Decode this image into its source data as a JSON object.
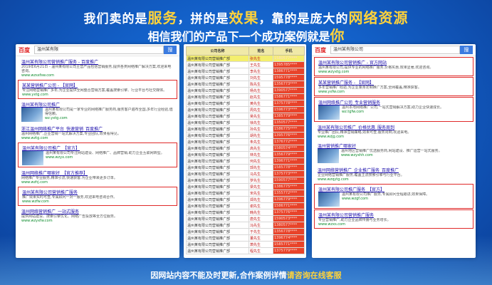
{
  "headline": {
    "line1_a": "我们卖的是",
    "line1_b": "服务",
    "line1_c": "，拼的是",
    "line1_d": "效果",
    "line1_e": "，靠的是庞大的",
    "line1_f": "网络资源",
    "line2_a": "相信我们的产品下一个成功案例就是",
    "line2_b": "你"
  },
  "left_panel": {
    "logo": "百度",
    "query": "温州某有限",
    "button": "搜",
    "results": [
      {
        "title": "温州某有限公司营销推广服务 - 百度推广",
        "snippet": "2019年6月21日 - 温州某有限公司主营产品包括营销服务,提供各类网络推广解决方案,欢迎来电咨询。",
        "url": "www.wzsxfsw.com",
        "boxed": false,
        "thumb": false
      },
      {
        "title": "某某营销推广公司 - 【官网】",
        "snippet": "专注网络营销推广多年,为企业提供全网整合营销方案,覆盖搜索引擎、行业平台与社交媒体。",
        "url": "www.yxtg.com",
        "boxed": true,
        "thumb": false
      },
      {
        "title": "温州某有限公司推广",
        "snippet": "温州某有限公司是一家专业的网络推广服务商,服务客户遍布全国,多年行业经验,值得信赖。",
        "url": "wz.yxtg.com",
        "boxed": false,
        "thumb": true
      },
      {
        "title": "浙江温州网络推广平台_快速营销_百度推广",
        "snippet": "温州网络推广,企业营销一站式解决方案,专业团队,效果看得见。",
        "url": "www.wztg.com",
        "boxed": false,
        "thumb": false
      },
      {
        "title": "温州某有限公司推广_【官方】",
        "snippet": "温州某有限公司专注网站建设、网络推广、品牌营销,助力企业互联网转型。",
        "url": "www.wzyx.com",
        "boxed": true,
        "thumb": true
      },
      {
        "title": "温州网络推广哪家好_【官方推荐】",
        "snippet": "网络推广专业服务,精准引流,快速获客,为企业带来更多订单。",
        "url": "www.wzhj.com",
        "boxed": false,
        "thumb": false
      },
      {
        "title": "温州某有限公司营销推广服务",
        "snippet": "推广效果实时可查,专属顾问一对一服务,欢迎来电咨询合作。",
        "url": "www.wzfw.com",
        "boxed": true,
        "thumb": false
      },
      {
        "title": "温州网络营销推广_一站式服务",
        "snippet": "提供网站建设、搜索引擎优化、网络广告投放等全方位服务。",
        "url": "www.wzyxfw.com",
        "boxed": false,
        "thumb": false
      }
    ]
  },
  "sheet": {
    "headers": [
      "公司名称",
      "姓名",
      "手机"
    ],
    "rows": [
      {
        "company": "温州某有限公司营销推广部",
        "name": "张先生",
        "phone": "1580577****"
      },
      {
        "company": "温州某有限公司营销推广部",
        "name": "王先生",
        "phone": "1395785****"
      },
      {
        "company": "温州某有限公司营销推广部",
        "name": "李先生",
        "phone": "1386771****"
      },
      {
        "company": "温州某有限公司营销推广部",
        "name": "刘先生",
        "phone": "1595778****"
      },
      {
        "company": "温州某有限公司营销推广部",
        "name": "陈先生",
        "phone": "1356773****"
      },
      {
        "company": "温州某有限公司营销推广部",
        "name": "杨先生",
        "phone": "1390577****"
      },
      {
        "company": "温州某有限公司营销推广部",
        "name": "赵先生",
        "phone": "1586771****"
      },
      {
        "company": "温州某有限公司营销推广部",
        "name": "黄先生",
        "phone": "1375778****"
      },
      {
        "company": "温州某有限公司营销推广部",
        "name": "周先生",
        "phone": "1596773****"
      },
      {
        "company": "温州某有限公司营销推广部",
        "name": "吴先生",
        "phone": "1385779****"
      },
      {
        "company": "温州某有限公司营销推广部",
        "name": "徐先生",
        "phone": "1350577****"
      },
      {
        "company": "温州某有限公司营销推广部",
        "name": "孙先生",
        "phone": "1586775****"
      },
      {
        "company": "温州某有限公司营销推广部",
        "name": "胡先生",
        "phone": "1395776****"
      },
      {
        "company": "温州某有限公司营销推广部",
        "name": "朱先生",
        "phone": "1376772****"
      },
      {
        "company": "温州某有限公司营销推广部",
        "name": "高先生",
        "phone": "1580574****"
      },
      {
        "company": "温州某有限公司营销推广部",
        "name": "林先生",
        "phone": "1356779****"
      },
      {
        "company": "温州某有限公司营销推广部",
        "name": "何先生",
        "phone": "1396771****"
      },
      {
        "company": "温州某有限公司营销推广部",
        "name": "郭先生",
        "phone": "1585778****"
      },
      {
        "company": "温州某有限公司营销推广部",
        "name": "马先生",
        "phone": "1375773****"
      },
      {
        "company": "温州某有限公司营销推广部",
        "name": "罗先生",
        "phone": "1590577****"
      },
      {
        "company": "温州某有限公司营销推广部",
        "name": "梁先生",
        "phone": "1386775****"
      },
      {
        "company": "温州某有限公司营销推广部",
        "name": "宋先生",
        "phone": "1355772****"
      },
      {
        "company": "温州某有限公司营销推广部",
        "name": "郑先生",
        "phone": "1396779****"
      },
      {
        "company": "温州某有限公司营销推广部",
        "name": "谢先生",
        "phone": "1586771****"
      },
      {
        "company": "温州某有限公司营销推广部",
        "name": "韩先生",
        "phone": "1375776****"
      },
      {
        "company": "温州某有限公司营销推广部",
        "name": "唐先生",
        "phone": "1590573****"
      },
      {
        "company": "温州某有限公司营销推广部",
        "name": "冯先生",
        "phone": "1380577****"
      },
      {
        "company": "温州某有限公司营销推广部",
        "name": "于先生",
        "phone": "1356778****"
      },
      {
        "company": "温州某有限公司营销推广部",
        "name": "董先生",
        "phone": "1396774****"
      },
      {
        "company": "温州某有限公司营销推广部",
        "name": "萧先生",
        "phone": "1585771****"
      },
      {
        "company": "温州某有限公司营销推广部",
        "name": "程先生",
        "phone": "1375779****"
      }
    ]
  },
  "right_panel": {
    "logo": "百度",
    "query": "温州某有限公司",
    "button": "搜",
    "results": [
      {
        "title": "温州某有限公司营销推广 - 官方网站",
        "snippet": "温州某有限公司,提供专业的网络推广服务,价格实惠,效果显著,欢迎咨询。",
        "url": "www.wzyxtg.com",
        "boxed": true,
        "thumb": false
      },
      {
        "title": "某某营销推广服务 - 【官网】",
        "snippet": "多年营销推广经验,为企业量身定制推广方案,全网覆盖,精准获客。",
        "url": "www.yxfw.com",
        "boxed": true,
        "thumb": false
      },
      {
        "title": "温州网络推广公司_专业营销服务",
        "snippet": "温州本地网络推广公司,一站式营销解决方案,助力企业快速成长。",
        "url": "wz.tgfw.com",
        "boxed": true,
        "thumb": true
      },
      {
        "title": "温州某有限公司推广_价格优惠_服务周到",
        "snippet": "专业推广团队,精准营销策略,效果可查,服务周到,欢迎来电。",
        "url": "www.wzjg.com",
        "boxed": false,
        "thumb": false
      },
      {
        "title": "温州营销推广哪家好",
        "snippet": "温州地区营销推广优选服务商,网站建设、推广运营一站式服务。",
        "url": "www.wzyxhh.com",
        "boxed": false,
        "thumb": true
      },
      {
        "title": "温州网络营销推广_企业推广服务_百度推广",
        "snippet": "企业网络营销推广服务,覆盖主流搜索引擎与行业平台。",
        "url": "www.wzqytg.com",
        "boxed": false,
        "thumb": false
      },
      {
        "title": "温州某有限公司推广服务_【官方】",
        "snippet": "温州某有限公司推广服务,专属顾问全程跟进,效果保障。",
        "url": "www.wzgf.com",
        "boxed": true,
        "thumb": true
      },
      {
        "title": "温州某有限公司营销推广服务",
        "snippet": "专业营销推广,助力企业品牌传播与业务增长。",
        "url": "www.wzxs.com",
        "boxed": true,
        "thumb": false
      }
    ]
  },
  "footer": {
    "text_a": "因网站内容不能及时更新,合作案例详情",
    "text_b": "请咨询在线客服"
  }
}
